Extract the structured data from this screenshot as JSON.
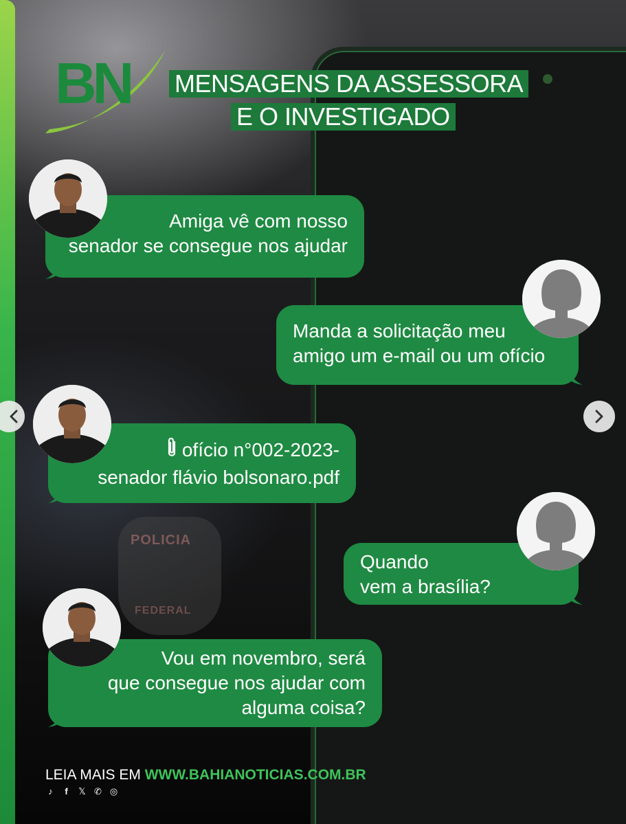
{
  "header": {
    "logo_text": "BN",
    "title_line1": "MENSAGENS DA ASSESSORA",
    "title_line2": "E O INVESTIGADO"
  },
  "background": {
    "badge_top": "POLICIA",
    "badge_bottom": "FEDERAL"
  },
  "messages": [
    {
      "sender": "investigado",
      "line1": "Amiga vê com nosso",
      "line2": "senador se consegue nos ajudar"
    },
    {
      "sender": "assessora",
      "line1": "Manda a solicitação meu",
      "line2": "amigo um e-mail ou um ofício"
    },
    {
      "sender": "investigado",
      "attachment_icon": "paperclip-icon",
      "line1": "ofício n°002-2023-",
      "line2": "senador flávio bolsonaro.pdf"
    },
    {
      "sender": "assessora",
      "line1": "Quando",
      "line2": "vem a brasília?"
    },
    {
      "sender": "investigado",
      "line1": "Vou em novembro, será",
      "line2": "que consegue nos ajudar com",
      "line3": "alguma coisa?"
    }
  ],
  "navigation": {
    "prev_icon": "chevron-left-icon",
    "next_icon": "chevron-right-icon"
  },
  "footer": {
    "lead": "LEIA MAIS EM ",
    "url": "WWW.BAHIANOTICIAS.COM.BR",
    "social_icons": [
      "tiktok-icon",
      "facebook-icon",
      "x-icon",
      "whatsapp-icon",
      "instagram-icon"
    ]
  },
  "colors": {
    "bubble": "#1f8a43",
    "title_bg": "#1d7a3a",
    "url": "#3ec35a",
    "accent_stripe": "#38b54a"
  }
}
